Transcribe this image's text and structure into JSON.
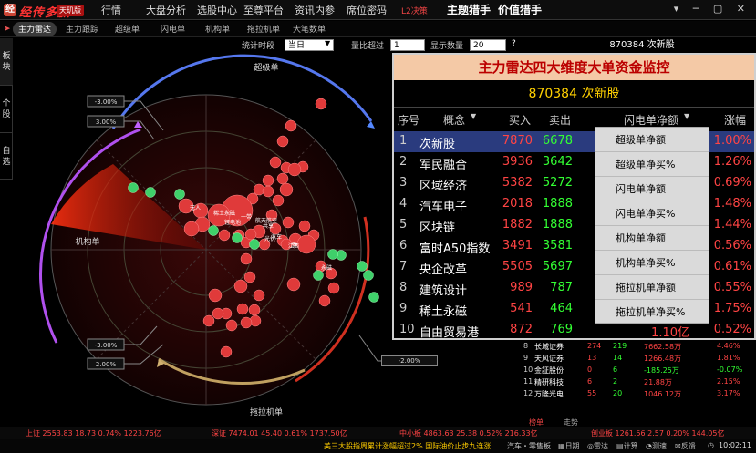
{
  "app": {
    "name": "经传多赢",
    "edition": "天玑版"
  },
  "menu": [
    "行情",
    "大盘分析",
    "选股中心",
    "至尊平台",
    "资讯内参",
    "席位密码",
    "L2决策",
    "主题猎手",
    "价值猎手"
  ],
  "subtabs": [
    "主力雷达",
    "主力跟踪",
    "超级单",
    "闪电单",
    "机构单",
    "拖拉机单",
    "大笔数单"
  ],
  "sidetabs": [
    "板块",
    "个股",
    "自选"
  ],
  "controls": {
    "period_label": "统计时段",
    "period_value": "当日",
    "ratio_label": "量比超过",
    "ratio_value": "1",
    "count_label": "显示数量",
    "count_value": "20",
    "help": "?"
  },
  "stock_header": "870384 次新股",
  "radar": {
    "top_label": "超级单",
    "left_label": "机构单",
    "bottom_label": "拖拉机单",
    "callouts": [
      "-3.00%",
      "3.00%",
      "-3.00%",
      "2.00%",
      "-2.00%"
    ],
    "bubble_labels": [
      "无人",
      "稀土永磁",
      "锂电池",
      "一带",
      "航天航空",
      "共享",
      "光伏",
      "汽车",
      "江西",
      "新",
      "永磁"
    ]
  },
  "panel": {
    "title": "主力雷达四大维度大单资金监控",
    "stock": "870384 次新股",
    "headers": [
      "序号",
      "概念",
      "买入",
      "卖出",
      "闪电单净额",
      "涨幅"
    ],
    "rows": [
      {
        "no": "1",
        "name": "次新股",
        "buy": "7870",
        "sell": "6678",
        "net": "",
        "chg": "1.00%"
      },
      {
        "no": "2",
        "name": "军民融合",
        "buy": "3936",
        "sell": "3642",
        "net": "",
        "chg": "1.26%"
      },
      {
        "no": "3",
        "name": "区域经济",
        "buy": "5382",
        "sell": "5272",
        "net": "",
        "chg": "0.69%"
      },
      {
        "no": "4",
        "name": "汽车电子",
        "buy": "2018",
        "sell": "1888",
        "net": "",
        "chg": "1.48%"
      },
      {
        "no": "5",
        "name": "区块链",
        "buy": "1882",
        "sell": "1888",
        "net": "",
        "chg": "1.44%"
      },
      {
        "no": "6",
        "name": "富时A50指数",
        "buy": "3491",
        "sell": "3581",
        "net": "",
        "chg": "0.56%"
      },
      {
        "no": "7",
        "name": "央企改革",
        "buy": "5505",
        "sell": "5697",
        "net": "",
        "chg": "0.61%"
      },
      {
        "no": "8",
        "name": "建筑设计",
        "buy": "989",
        "sell": "787",
        "net": "",
        "chg": "0.55%"
      },
      {
        "no": "9",
        "name": "稀土永磁",
        "buy": "541",
        "sell": "464",
        "net": "",
        "chg": "1.75%"
      },
      {
        "no": "10",
        "name": "自由贸易港",
        "buy": "872",
        "sell": "769",
        "net": "1.10亿",
        "chg": "0.52%"
      }
    ],
    "dropdown": [
      "超级单净额",
      "超级单净买%",
      "闪电单净额",
      "闪电单净买%",
      "机构单净额",
      "机构单净买%",
      "拖拉机单净额",
      "拖拉机单净买%"
    ]
  },
  "lower": {
    "rows": [
      {
        "no": "8",
        "name": "长城证券",
        "a": "274",
        "b": "219",
        "c": "7662.58万",
        "d": "4.46%"
      },
      {
        "no": "9",
        "name": "天风证券",
        "a": "13",
        "b": "14",
        "c": "1266.48万",
        "d": "1.81%"
      },
      {
        "no": "10",
        "name": "金証股份",
        "a": "0",
        "b": "6",
        "c": "-185.25万",
        "d": "-0.07%"
      },
      {
        "no": "11",
        "name": "精研科技",
        "a": "6",
        "b": "2",
        "c": "21.88万",
        "d": "2.15%"
      },
      {
        "no": "12",
        "name": "万隆光电",
        "a": "55",
        "b": "20",
        "c": "1046.12万",
        "d": "3.17%"
      }
    ],
    "tabs": [
      "榜单",
      "走势"
    ]
  },
  "status": {
    "sh": "上证 2553.83 18.73 0.74% 1223.76亿",
    "sz": "深证 7474.01 45.40 0.61% 1737.50亿",
    "zxb": "中小板 4863.63 25.38 0.52% 216.33亿",
    "cyb": "创业板 1261.56 2.57 0.20% 144.05亿"
  },
  "bottom": {
    "news": "美三大股指周累计涨幅超过2%  国际油价止步九连涨",
    "item": "汽车・零售板",
    "tools": [
      "日期",
      "雷达",
      "计算",
      "测速",
      "反馈"
    ],
    "time": "10:02:11"
  }
}
